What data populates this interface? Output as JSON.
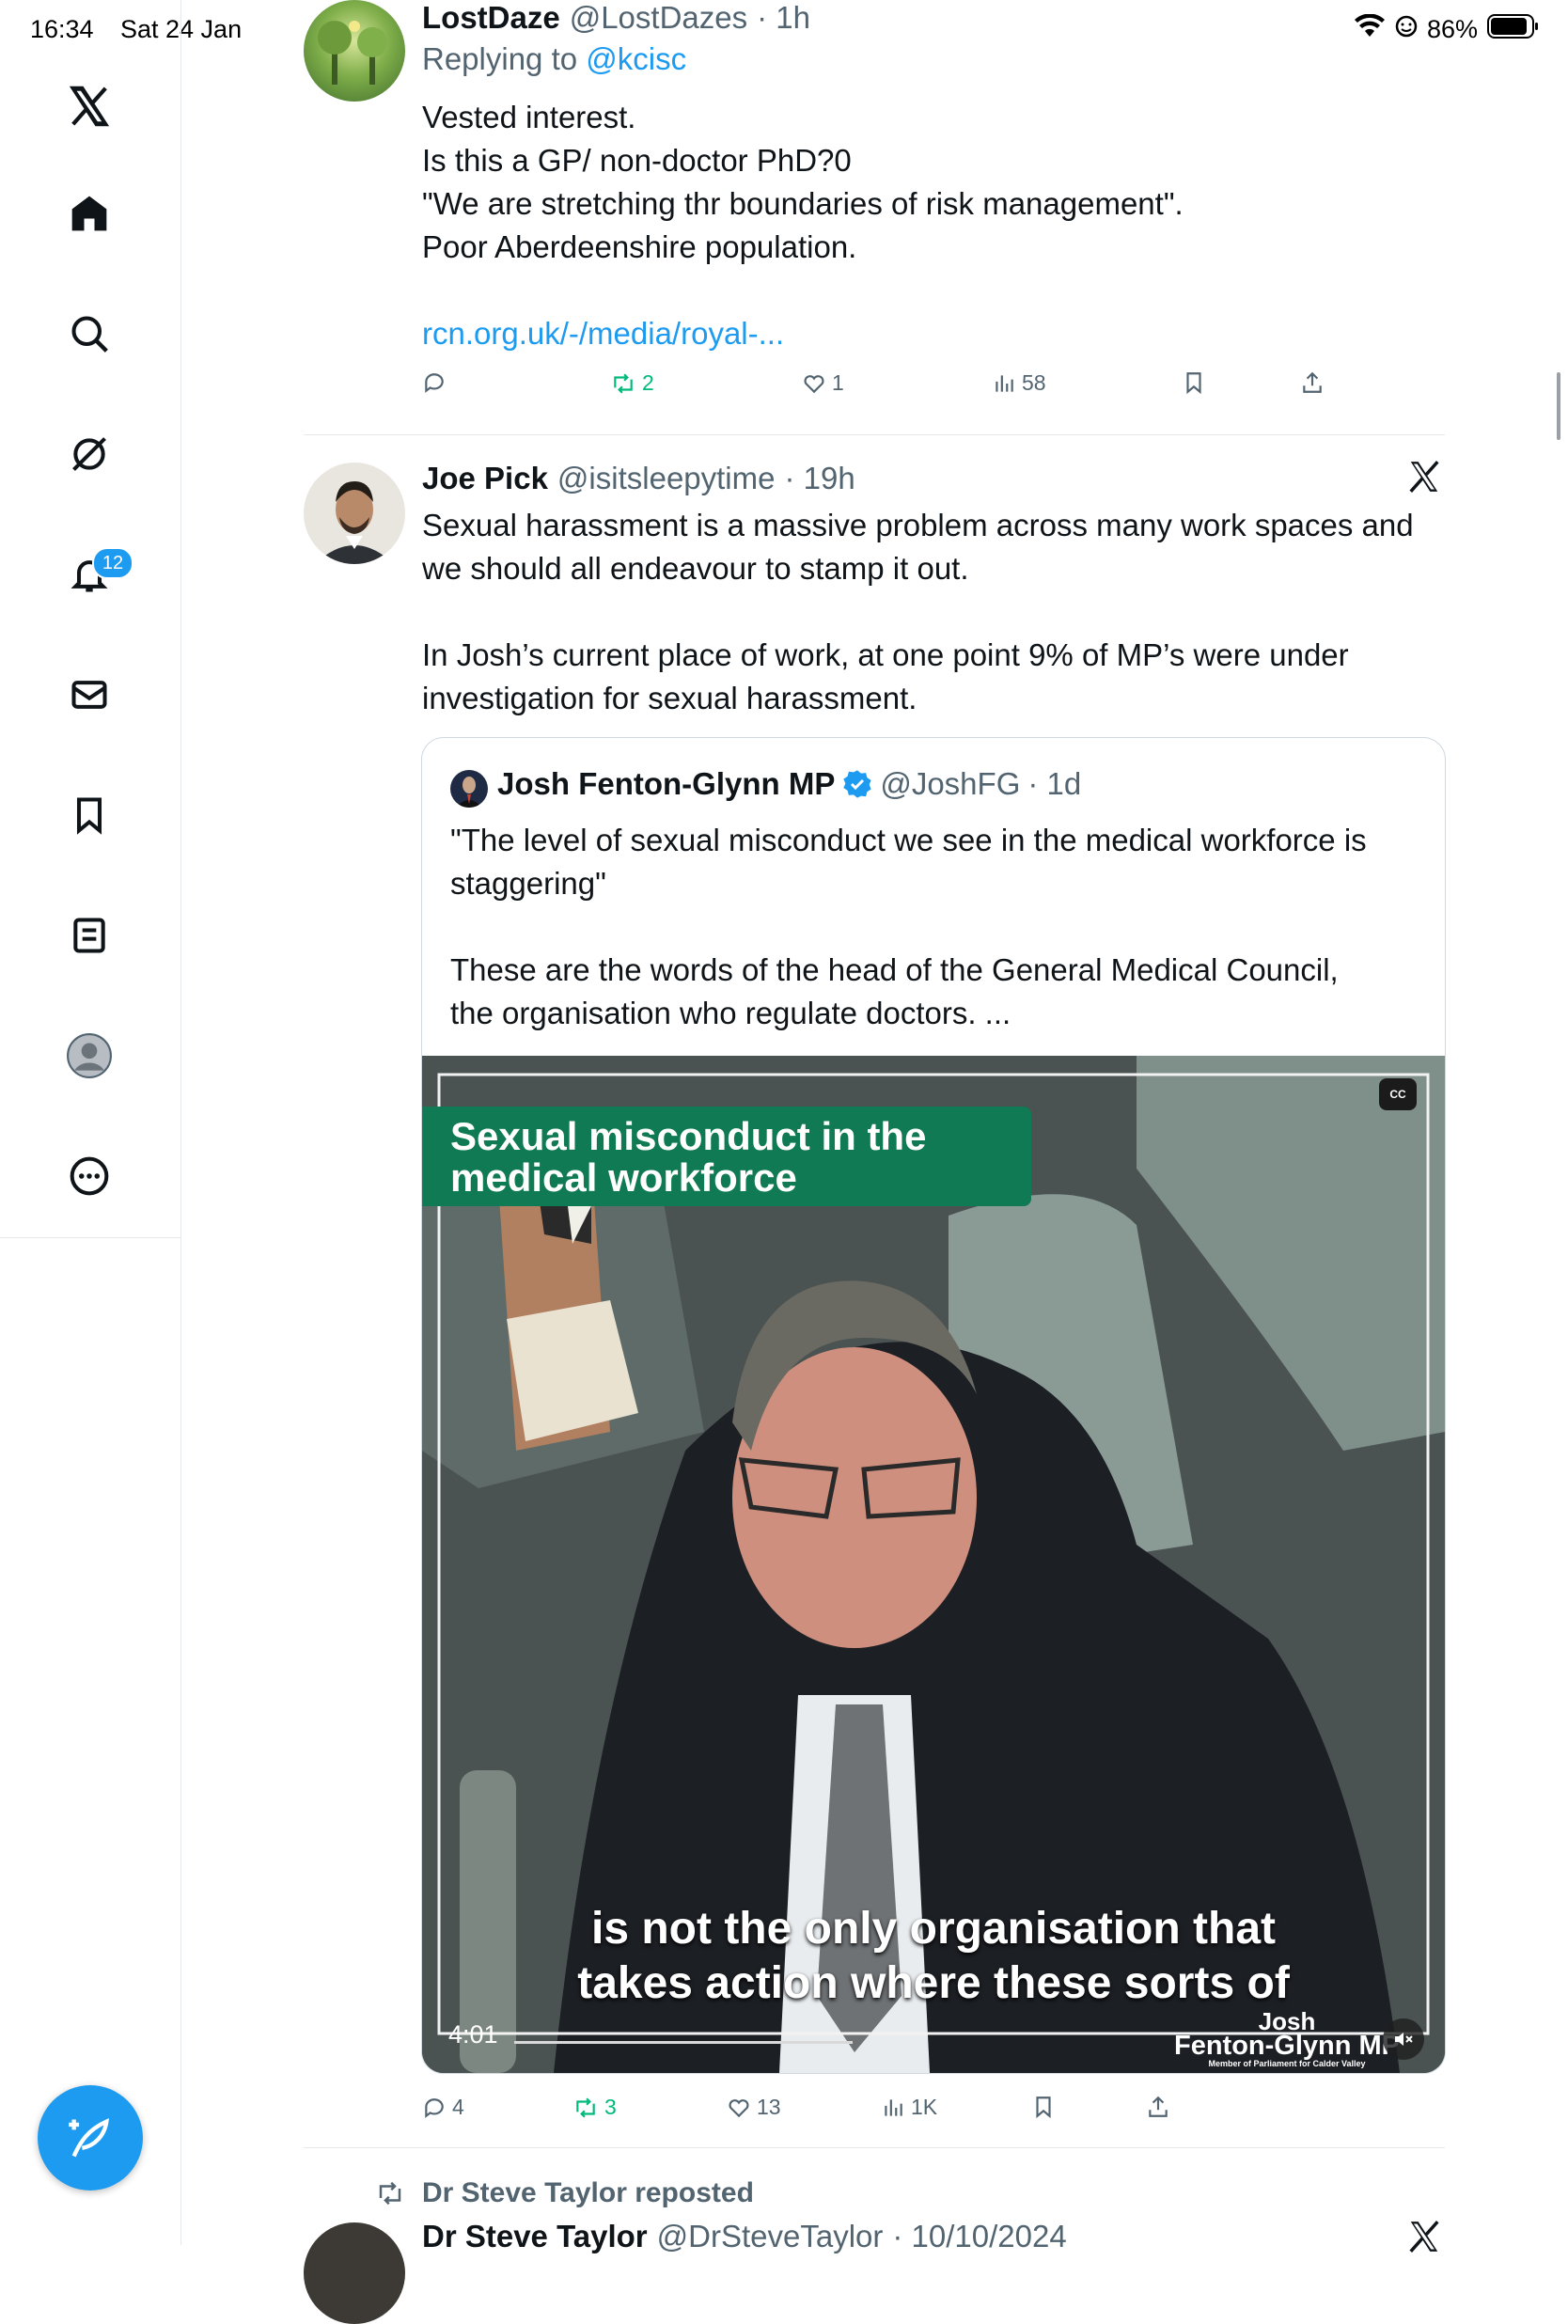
{
  "status_bar": {
    "time": "16:34",
    "date": "Sat 24 Jan",
    "battery": "86%"
  },
  "sidebar": {
    "notifications_badge": "12",
    "items": [
      "x-logo",
      "home",
      "search",
      "grok",
      "notifications",
      "messages",
      "bookmarks",
      "lists",
      "profile",
      "more"
    ]
  },
  "tweets": [
    {
      "name": "LostDaze",
      "handle": "@LostDazes",
      "time": "· 1h",
      "replying_label": "Replying to",
      "replying_to": "@kcisc",
      "lines": [
        "Vested interest.",
        "Is this a GP/ non-doctor PhD?0",
        "\"We are stretching thr boundaries of risk management\".",
        "Poor Aberdeenshire population."
      ],
      "link": "rcn.org.uk/-/media/royal-...",
      "retweets": "2",
      "likes": "1",
      "views": "58"
    },
    {
      "name": "Joe Pick",
      "handle": "@isitsleepytime",
      "time": "· 19h",
      "lines": [
        "Sexual harassment is a massive problem across many work spaces and",
        "we should all endeavour to stamp it out.",
        "In Josh’s current place of work, at one point 9% of MP’s were under",
        "investigation for sexual harassment."
      ],
      "quote": {
        "name": "Josh Fenton-Glynn MP",
        "handle": "@JoshFG",
        "time": "· 1d",
        "lines": [
          "\"The level of sexual misconduct we see in the medical workforce is",
          "staggering\"",
          "These are the words of the head of the General Medical Council,",
          "the organisation who regulate doctors. ..."
        ],
        "video": {
          "banner_line1": "Sexual misconduct in the",
          "banner_line2": "medical workforce",
          "caption_line1": "is not the only organisation that",
          "caption_line2": "takes action where these sorts of",
          "duration": "4:01",
          "cc": "CC",
          "watermark_line1": "Josh",
          "watermark_line2": "Fenton-Glynn MP",
          "watermark_sub": "Member of Parliament for Calder Valley"
        }
      },
      "replies": "4",
      "retweets": "3",
      "likes": "13",
      "views": "1K"
    },
    {
      "repost_label": "Dr Steve Taylor reposted",
      "name": "Dr Steve Taylor",
      "handle": "@DrSteveTaylor",
      "time": "· 10/10/2024"
    }
  ]
}
